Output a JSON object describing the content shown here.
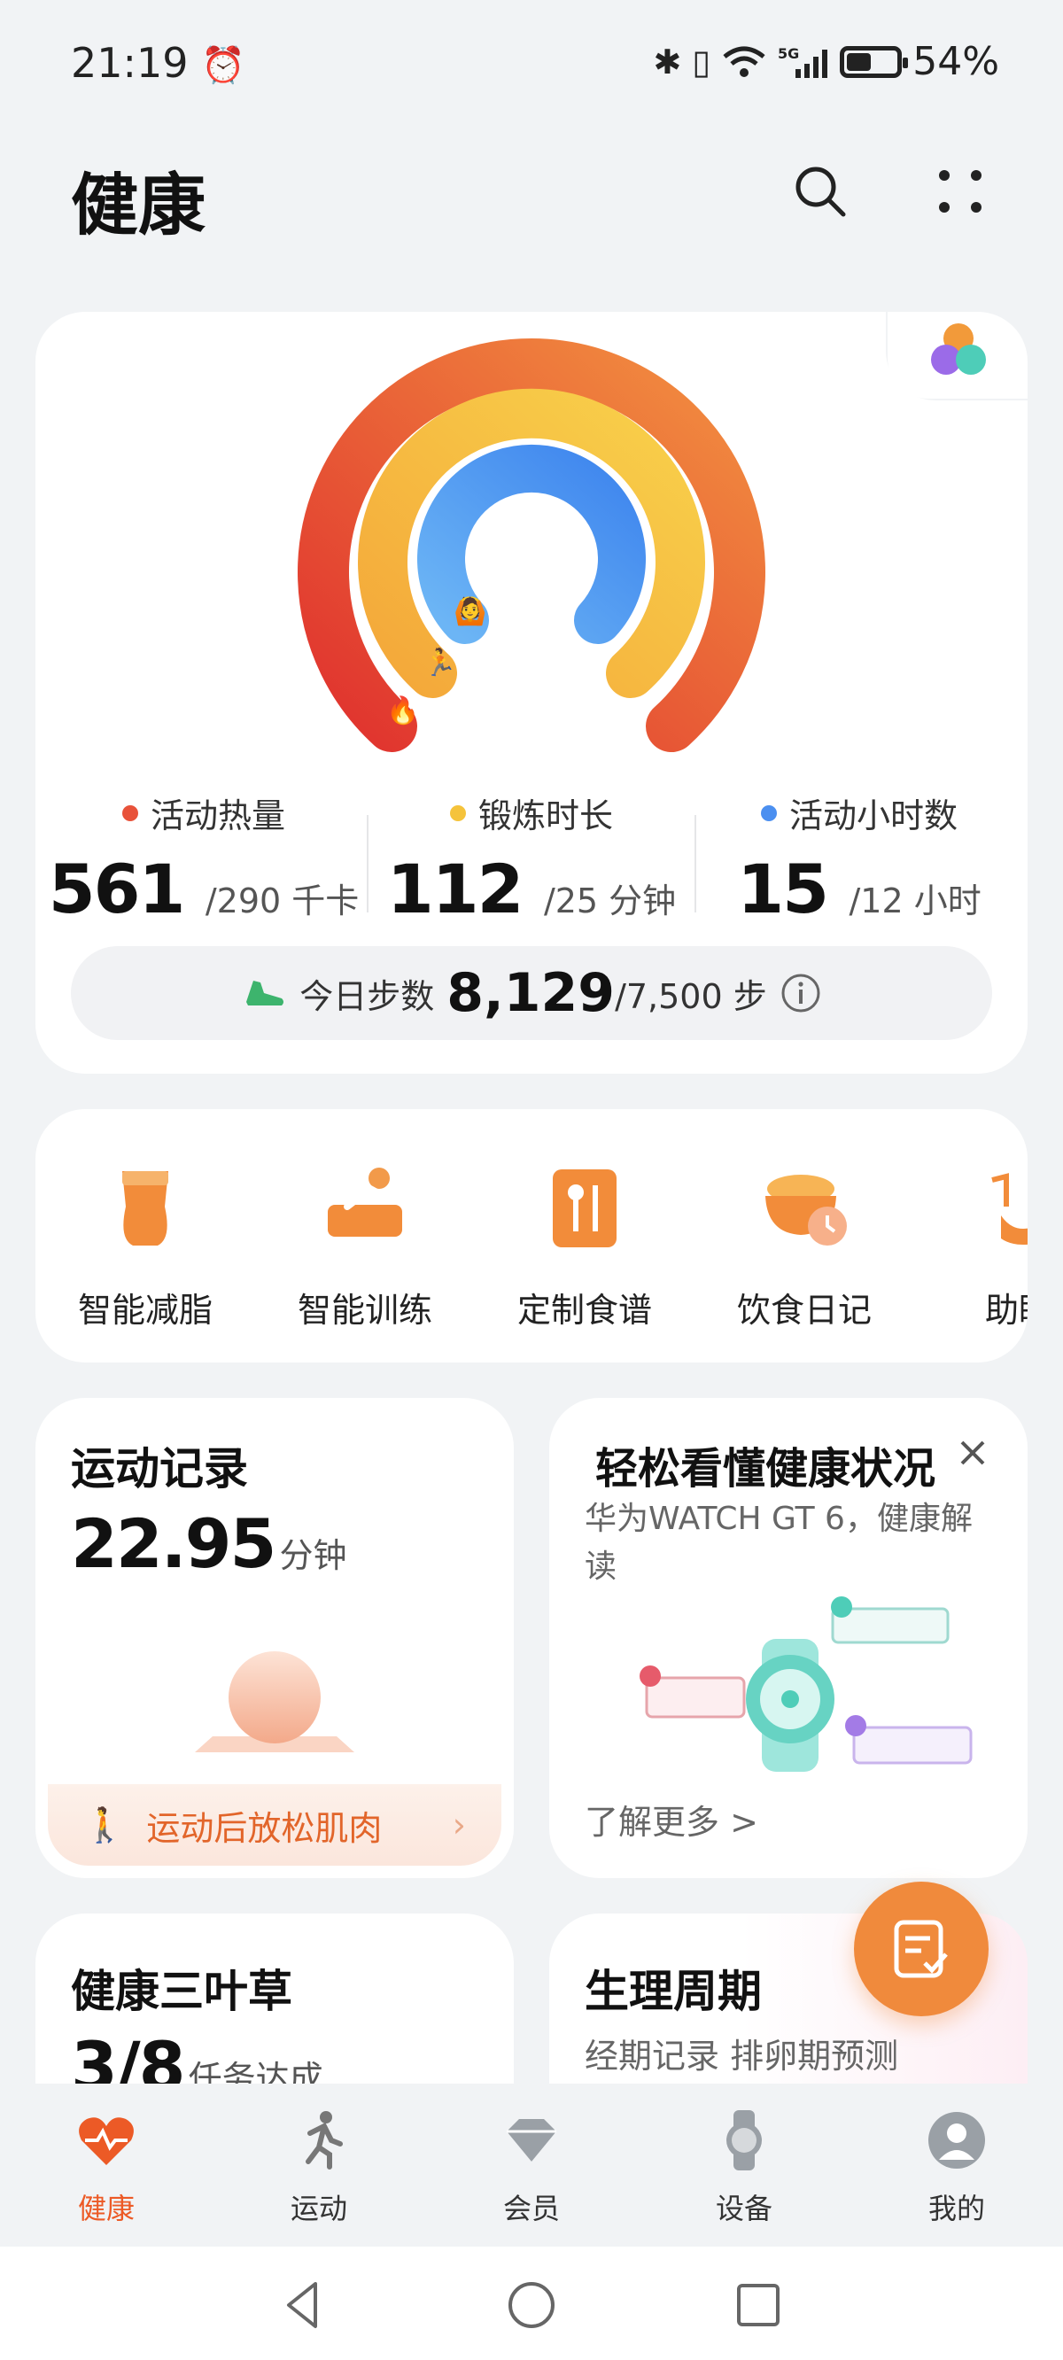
{
  "status_bar": {
    "time": "21:19",
    "battery": "54%",
    "battery_level": 0.54
  },
  "header": {
    "title": "健康"
  },
  "rings": {
    "metrics": [
      {
        "label": "活动热量",
        "value": "561",
        "goal": "/290 千卡",
        "color": "#e8523a"
      },
      {
        "label": "锻炼时长",
        "value": "112",
        "goal": "/25 分钟",
        "color": "#f5c33b"
      },
      {
        "label": "活动小时数",
        "value": "15",
        "goal": "/12 小时",
        "color": "#4b8ff0"
      }
    ],
    "steps_label": "今日步数",
    "steps_value": "8,129",
    "steps_goal": "/7,500 步"
  },
  "shortcuts": [
    {
      "label": "智能减脂",
      "icon": "body-fat-icon"
    },
    {
      "label": "智能训练",
      "icon": "training-icon"
    },
    {
      "label": "定制食谱",
      "icon": "recipe-icon"
    },
    {
      "label": "饮食日记",
      "icon": "diet-diary-icon"
    },
    {
      "label": "助眠",
      "icon": "sleep-aid-icon"
    }
  ],
  "sport_record": {
    "title": "运动记录",
    "value": "22.95",
    "unit": "分钟",
    "tip": "运动后放松肌肉"
  },
  "health_status": {
    "title": "轻松看懂健康状况",
    "subtitle": "华为WATCH GT 6，健康解读",
    "more": "了解更多 >"
  },
  "clover": {
    "title": "健康三叶草",
    "value": "3/8",
    "unit": "任务达成"
  },
  "period": {
    "title": "生理周期",
    "subtitle": "经期记录 排卵期预测"
  },
  "bottom_nav": [
    {
      "label": "健康",
      "active": true
    },
    {
      "label": "运动",
      "active": false
    },
    {
      "label": "会员",
      "active": false
    },
    {
      "label": "设备",
      "active": false
    },
    {
      "label": "我的",
      "active": false
    }
  ],
  "colors": {
    "accent": "#ec5a26",
    "fab": "#f08a3c"
  }
}
